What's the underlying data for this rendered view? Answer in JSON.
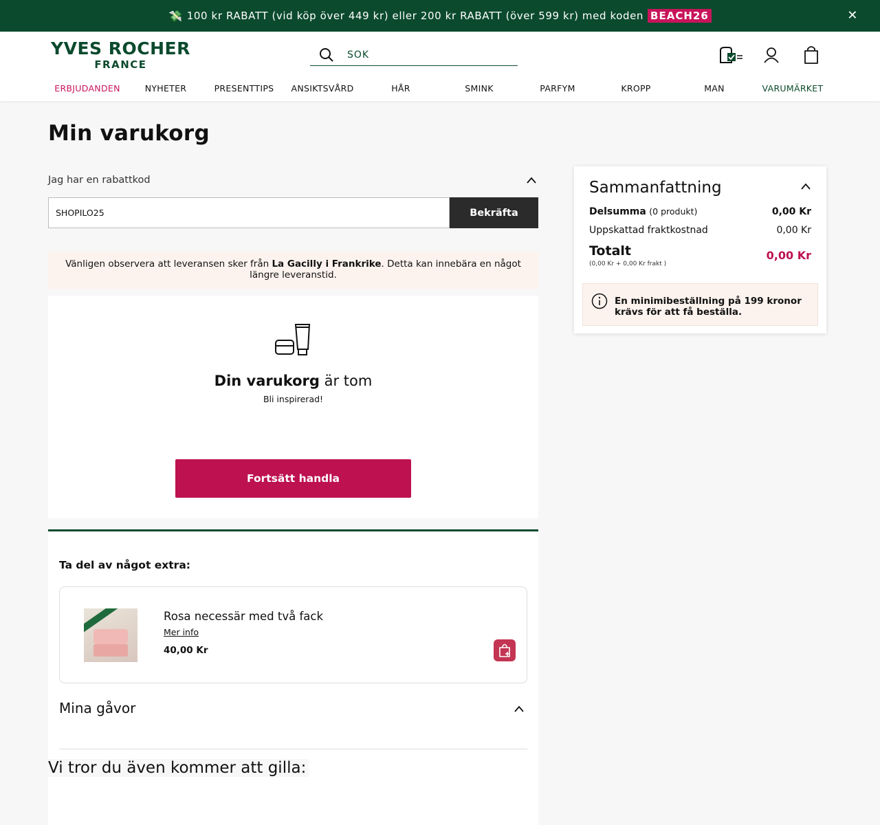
{
  "promo": {
    "text": "100 kr RABATT (vid köp över 449 kr) eller 200 kr RABATT (över 599 kr) med koden",
    "code": "BEACH26",
    "icon": "money-icon",
    "close": "✕"
  },
  "header": {
    "logo_line1": "YVES ROCHER",
    "logo_line2": "FRANCE",
    "search_placeholder": "SÖK",
    "icons": [
      "store-locator-icon",
      "account-icon",
      "cart-icon"
    ]
  },
  "nav": {
    "items": [
      "ERBJUDANDEN",
      "NYHETER",
      "PRESENTTIPS",
      "ANSIKTSVÅRD",
      "HÅR",
      "SMINK",
      "PARFYM",
      "KROPP",
      "MAN",
      "VARUMÄRKET"
    ]
  },
  "page": {
    "title": "Min varukorg"
  },
  "discount": {
    "label": "Jag har en rabattkod",
    "value": "SHOPILO25",
    "button": "Bekräfta"
  },
  "notice": {
    "before": "Vänligen observera att leveransen sker från ",
    "bold": "La Gacilly i Frankrike",
    "after": ". Detta kan innebära en något längre leveranstid."
  },
  "empty": {
    "title_bold": "Din varukorg",
    "title_rest": " är tom",
    "subtitle": "Bli inspirerad!",
    "cta": "Fortsätt handla"
  },
  "extra": {
    "label": "Ta del av något extra:",
    "product": {
      "name": "Rosa necessär med två fack",
      "more": "Mer info",
      "price": "40,00 Kr"
    },
    "gifts_title": "Mina gåvor",
    "also_like": "Vi tror du även kommer att gilla:"
  },
  "summary": {
    "title": "Sammanfattning",
    "subtotal_label": "Delsumma",
    "subtotal_count": "(0 produkt)",
    "subtotal_value": "0,00 Kr",
    "shipping_label": "Uppskattad fraktkostnad",
    "shipping_value": "0,00 Kr",
    "total_label": "Totalt",
    "total_breakdown": "(0,00 Kr + 0,00 Kr frakt )",
    "total_value": "0,00 Kr",
    "min_order": "En minimibeställning på 199 kronor krävs för att få beställa."
  },
  "colors": {
    "brand_green": "#0b4a2d",
    "accent_pink": "#bd1150",
    "promo_code_bg": "#c8145a"
  }
}
